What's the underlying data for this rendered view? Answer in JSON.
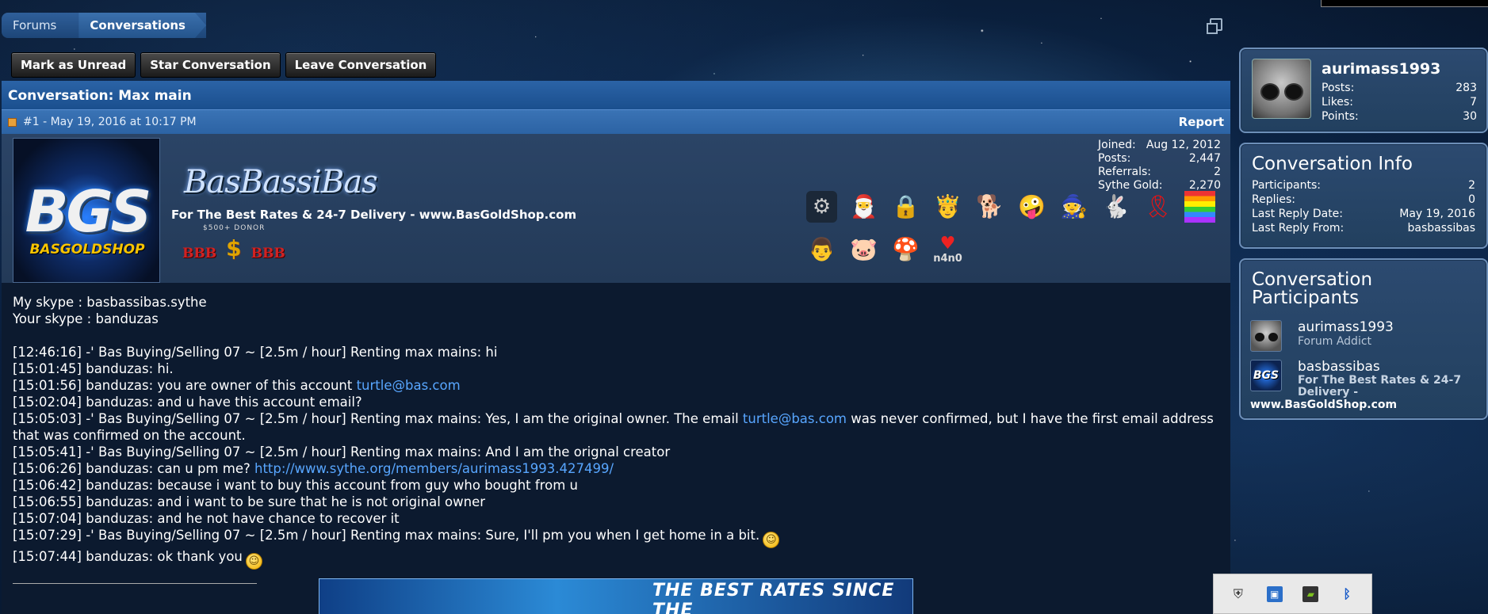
{
  "breadcrumb": {
    "items": [
      "Forums",
      "Conversations"
    ]
  },
  "actions": {
    "mark_unread": "Mark as Unread",
    "star": "Star Conversation",
    "leave": "Leave Conversation"
  },
  "conversation": {
    "title": "Conversation: Max main",
    "post_meta": "#1 - May 19, 2016 at 10:17 PM",
    "report_label": "Report"
  },
  "poster": {
    "avatar_text": "BGS",
    "avatar_sub": "BASGOLDSHOP",
    "signature_name": "BasBassiBas",
    "user_title": "For The Best Rates & 24-7 Delivery - www.BasGoldShop.com",
    "donor_label": "$500+ DONOR",
    "badge_left": "BBB",
    "badge_right": "BBB",
    "stats": [
      {
        "label": "Joined:",
        "value": "Aug 12, 2012"
      },
      {
        "label": "Posts:",
        "value": "2,447"
      },
      {
        "label": "Referrals:",
        "value": "2"
      },
      {
        "label": "Sythe Gold:",
        "value": "2,270"
      }
    ],
    "trophy_icons": [
      "steam-icon",
      "santa-icon",
      "padlock-icon",
      "king-icon",
      "doge-icon",
      "cartoon-icon",
      "wizard-icon",
      "bunny-icon",
      "ribbon-icon",
      "rainbow-icon",
      "man-icon",
      "pig-icon",
      "mushroom-icon"
    ],
    "n4n0_label": "n4n0"
  },
  "message": {
    "lines": [
      "My skype : basbassibas.sythe",
      "Your skype : banduzas",
      "",
      "[12:46:16] -' Bas Buying/Selling 07 ~ [2.5m / hour] Renting max mains: hi",
      "[15:01:45] banduzas: hi.",
      "[15:01:56] banduzas: you are owner of this account ",
      "[15:02:04] banduzas: and u have this account email?",
      "[15:05:03] -' Bas Buying/Selling 07 ~ [2.5m / hour] Renting max mains: Yes, I am the original owner. The email ",
      " was never confirmed, but I have the first email address that was confirmed on the account.",
      "[15:05:41] -' Bas Buying/Selling 07 ~ [2.5m / hour] Renting max mains: And I am the orignal creator",
      "[15:06:26] banduzas: can u pm me? ",
      "[15:06:42] banduzas: because i want to buy this account from guy who bought from u",
      "[15:06:55] banduzas: and i want to be sure that he is not original owner",
      "[15:07:04] banduzas: and he not have chance to recover it",
      "[15:07:29] -' Bas Buying/Selling 07 ~ [2.5m / hour] Renting max mains: Sure, I'll pm you when I get home in a bit.",
      "[15:07:44] banduzas: ok thank you"
    ],
    "email_link": "turtle@bas.com",
    "profile_link": "http://www.sythe.org/members/aurimass1993.427499/",
    "banner_text": "THE BEST RATES SINCE THE"
  },
  "sidebar": {
    "user": {
      "name": "aurimass1993",
      "stats": [
        {
          "label": "Posts:",
          "value": "283"
        },
        {
          "label": "Likes:",
          "value": "7"
        },
        {
          "label": "Points:",
          "value": "30"
        }
      ]
    },
    "info": {
      "title": "Conversation Info",
      "rows": [
        {
          "label": "Participants:",
          "value": "2"
        },
        {
          "label": "Replies:",
          "value": "0"
        },
        {
          "label": "Last Reply Date:",
          "value": "May 19, 2016"
        },
        {
          "label": "Last Reply From:",
          "value": "basbassibas"
        }
      ]
    },
    "participants": {
      "title": "Conversation Participants",
      "items": [
        {
          "name": "aurimass1993",
          "role": "Forum Addict"
        },
        {
          "name": "basbassibas",
          "role": "For The Best Rates & 24-7 Delivery -",
          "tagline": "www.BasGoldShop.com"
        }
      ]
    }
  },
  "colors": {
    "accent": "#2b63a6",
    "link": "#58a6ff",
    "panel": "#2c4a70"
  },
  "tray_icons": [
    "shield-icon",
    "monitor-icon",
    "nvidia-icon",
    "bluetooth-icon"
  ]
}
